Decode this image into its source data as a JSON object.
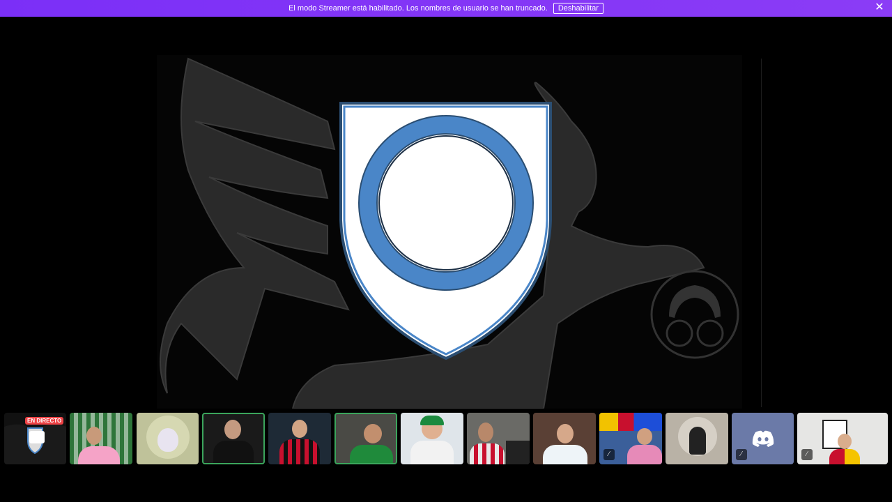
{
  "banner": {
    "message": "El modo Streamer está habilitado. Los nombres de usuario se han truncado.",
    "button_label": "Deshabilitar",
    "close_icon": "close-icon"
  },
  "stage": {
    "content": "stream-screen-share",
    "shield_colors": {
      "fill": "#ffffff",
      "ring": "#4a86c8",
      "border": "#2b4e72"
    }
  },
  "participants": {
    "live_label": "EN DIRECTO",
    "tiles": [
      {
        "id": "stream",
        "live": true
      },
      {
        "id": "p1"
      },
      {
        "id": "p2"
      },
      {
        "id": "p3",
        "speaking": true
      },
      {
        "id": "p4"
      },
      {
        "id": "p5",
        "speaking": true
      },
      {
        "id": "p6"
      },
      {
        "id": "p7"
      },
      {
        "id": "p8"
      },
      {
        "id": "p9",
        "muted": true
      },
      {
        "id": "p10"
      },
      {
        "id": "p11",
        "muted": true,
        "discord": true
      },
      {
        "id": "p12",
        "muted": true
      }
    ]
  }
}
